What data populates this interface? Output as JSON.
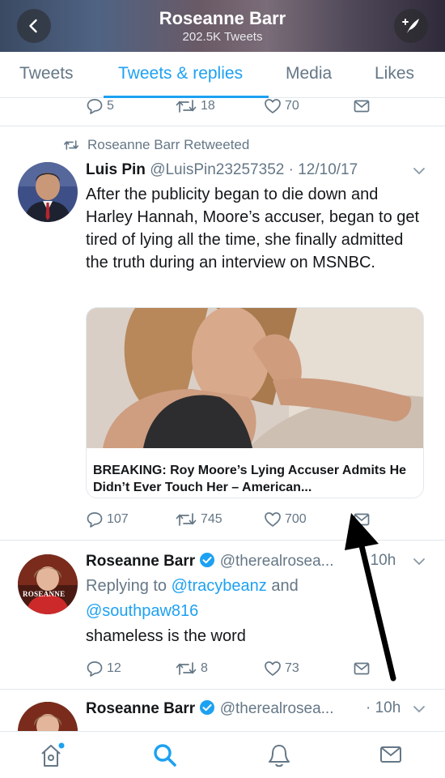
{
  "header": {
    "title": "Roseanne Barr",
    "subtitle": "202.5K Tweets",
    "back_icon": "chevron-left-icon",
    "compose_icon": "compose-tweet-icon"
  },
  "tabs": [
    {
      "label": "Tweets"
    },
    {
      "label": "Tweets & replies"
    },
    {
      "label": "Media"
    },
    {
      "label": "Likes"
    }
  ],
  "tweet0": {
    "replies": "5",
    "retweets": "18",
    "likes": "70"
  },
  "tweet1": {
    "retweeted_by": "Roseanne Barr Retweeted",
    "name": "Luis Pin",
    "handle_date": "@LuisPin23257352 · 12/10/17",
    "text": "After the publicity began to die down and Harley Hannah, Moore’s accuser, began to get tired of lying all the time, she finally admitted the truth during an interview on MSNBC.",
    "card_title": "BREAKING: Roy Moore’s Lying Accuser Admits He Didn’t Ever Touch Her – American...",
    "replies": "107",
    "retweets": "745",
    "likes": "700"
  },
  "tweet2": {
    "name": "Roseanne Barr",
    "handle": "@therealrosea...",
    "time": "· 10h",
    "reply_prefix": "Replying to ",
    "mention1": "@tracybeanz",
    "and": " and",
    "mention2": "@southpaw816",
    "text": "shameless is the word",
    "avatar_text": "ROSEANNE",
    "replies": "12",
    "retweets": "8",
    "likes": "73"
  },
  "tweet3": {
    "name": "Roseanne Barr",
    "handle": "@therealrosea...",
    "time": "· 10h"
  },
  "colors": {
    "accent": "#1da1f2",
    "muted": "#657786",
    "verified": "#1da1f2"
  }
}
